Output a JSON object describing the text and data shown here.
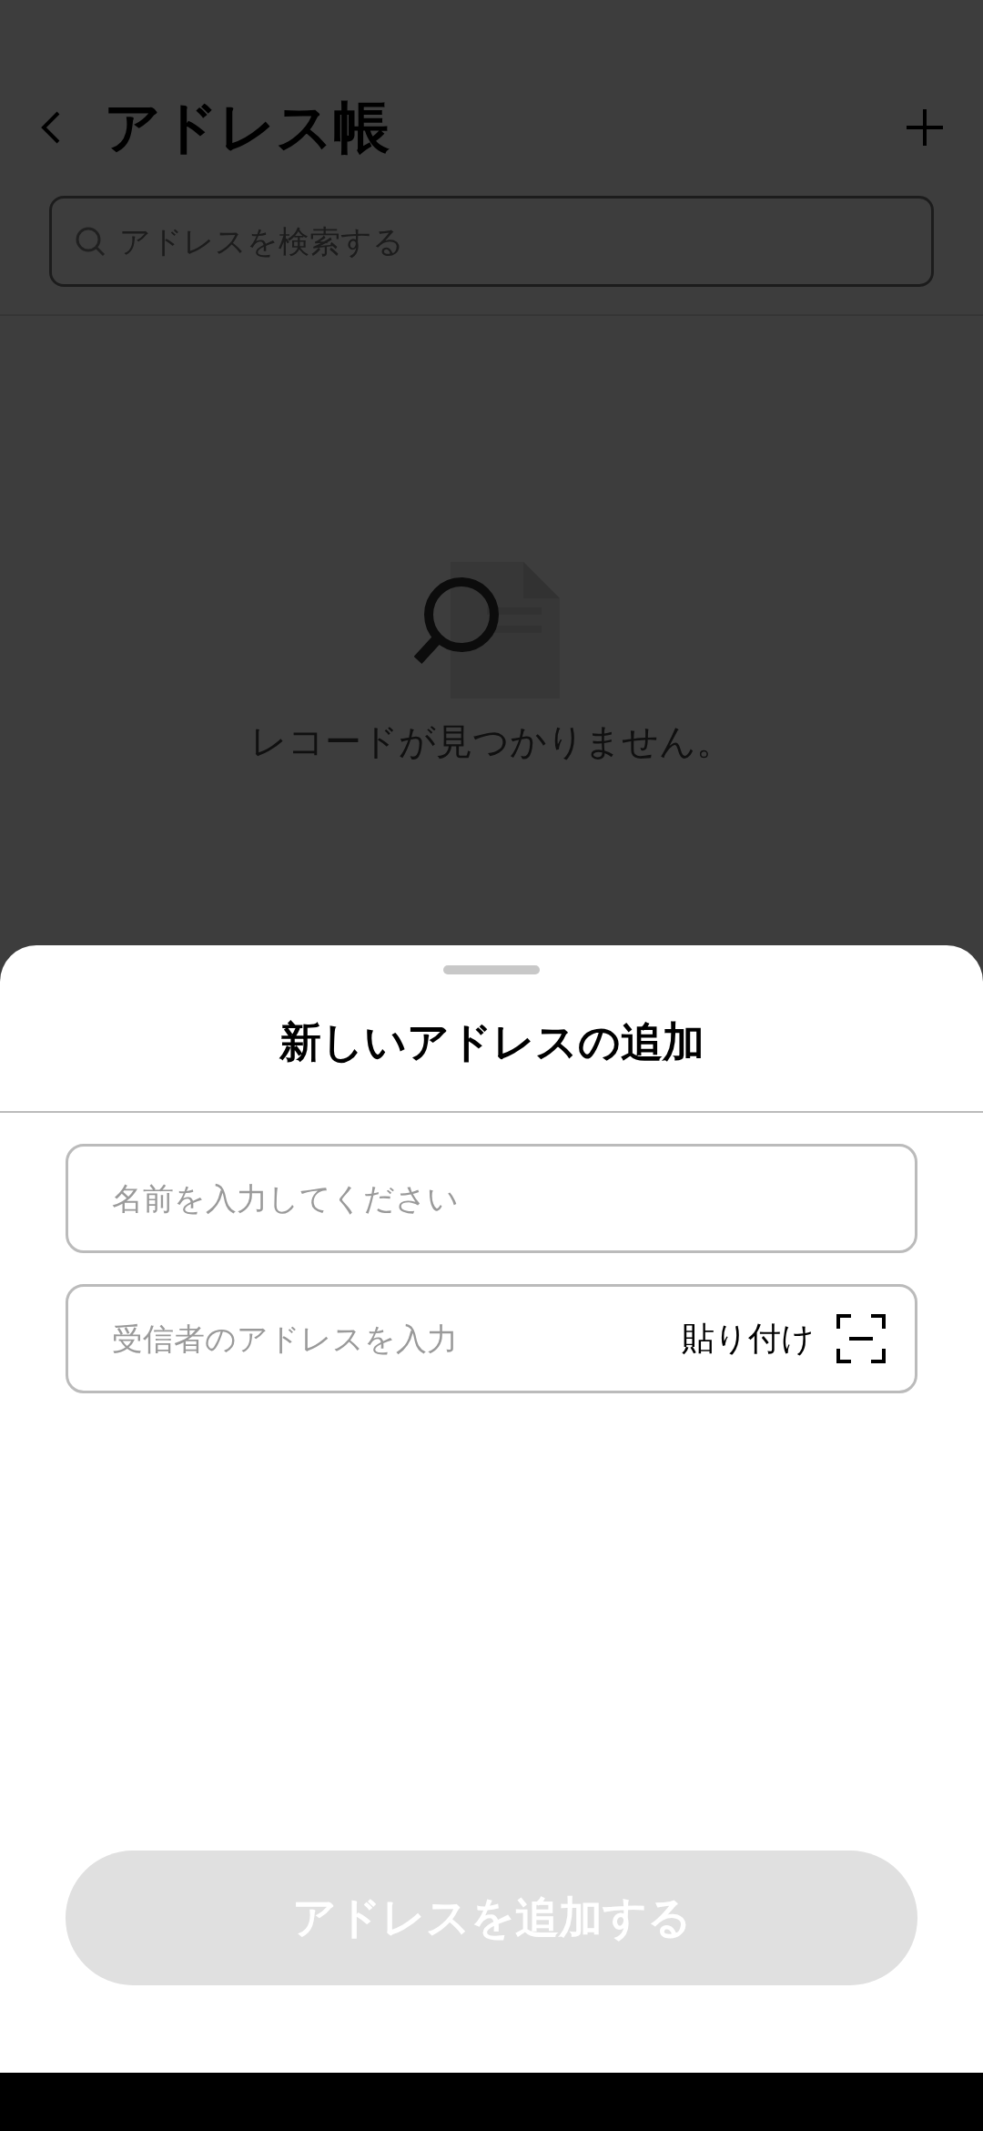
{
  "header": {
    "title": "アドレス帳"
  },
  "search": {
    "placeholder": "アドレスを検索する"
  },
  "empty_state": {
    "message": "レコードが見つかりません。"
  },
  "sheet": {
    "title": "新しいアドレスの追加",
    "fields": [
      {
        "kind": "text",
        "placeholder": "名前を入力してください"
      },
      {
        "kind": "address",
        "placeholder": "受信者のアドレスを入力",
        "paste_label": "貼り付け"
      }
    ],
    "submit": {
      "label": "アドレスを追加する",
      "disabled": true
    }
  }
}
